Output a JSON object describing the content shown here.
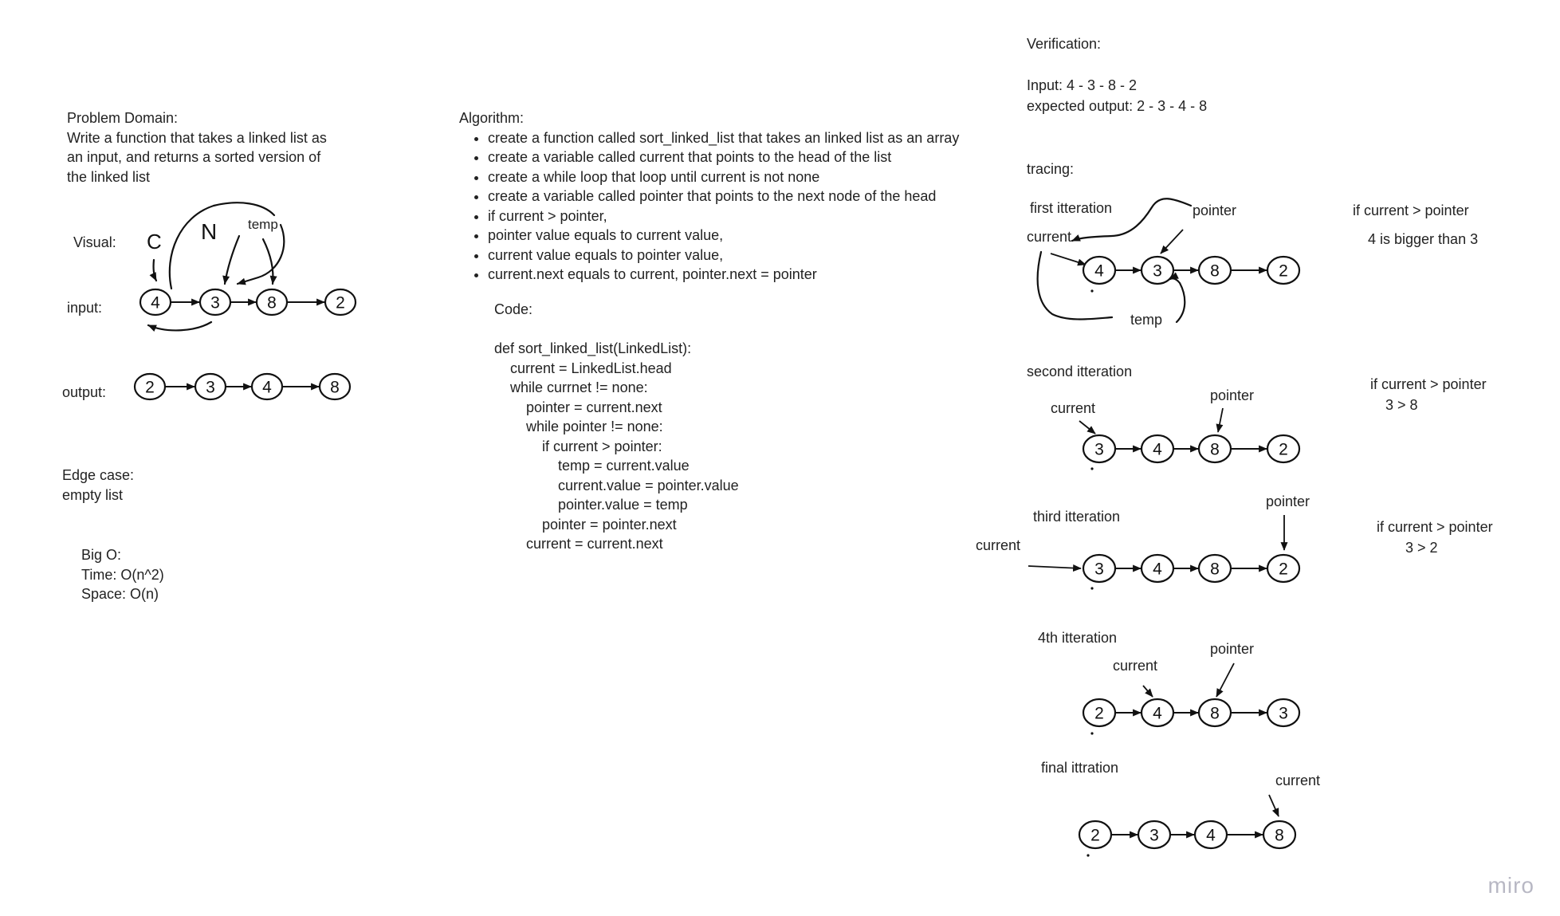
{
  "problem": {
    "heading": "Problem Domain:",
    "lines": [
      "Write a function that takes a linked list as",
      "an input, and returns a sorted version of",
      "the linked list"
    ]
  },
  "visual_label": "Visual:",
  "visual_marks": {
    "c": "C",
    "n": "N",
    "temp": "temp"
  },
  "input_label": "input:",
  "output_label": "output:",
  "input_list": [
    4,
    3,
    8,
    2
  ],
  "output_list": [
    2,
    3,
    4,
    8
  ],
  "edge": {
    "heading": "Edge case:",
    "text": "empty list"
  },
  "bigo": {
    "heading": "Big O:",
    "time": "Time: O(n^2)",
    "space": "Space: O(n)"
  },
  "algorithm": {
    "heading": "Algorithm:",
    "steps": [
      "create a function called sort_linked_list that takes an linked list as an array",
      "create a variable called current that points to the head of the list",
      "create a while loop that loop until current is not none",
      "create a variable called pointer that points to the next node of the head",
      "if current > pointer,",
      "pointer value equals to current value,",
      "current value equals to pointer value,",
      "current.next equals to current, pointer.next = pointer"
    ]
  },
  "code": {
    "heading": "Code:",
    "lines": [
      "def sort_linked_list(LinkedList):",
      "",
      "    current = LinkedList.head",
      "",
      "    while currnet != none:",
      "        pointer = current.next",
      "        while pointer != none:",
      "            if current > pointer:",
      "                temp = current.value",
      "                current.value = pointer.value",
      "                pointer.value = temp",
      "            pointer = pointer.next",
      "        current = current.next"
    ]
  },
  "verification": {
    "heading": "Verification:",
    "input": "Input: 4 - 3 - 8 - 2",
    "expected": "expected output: 2 - 3 - 4 - 8",
    "tracing": "tracing:"
  },
  "iterations": [
    {
      "title": "first itteration",
      "nodes": [
        4,
        3,
        8,
        2
      ],
      "current_label": "current",
      "pointer_label": "pointer",
      "temp_label": "temp",
      "cond": "if current > pointer",
      "note": "4 is bigger than 3"
    },
    {
      "title": "second itteration",
      "nodes": [
        3,
        4,
        8,
        2
      ],
      "current_label": "current",
      "pointer_label": "pointer",
      "cond": "if current > pointer",
      "note": "3 > 8"
    },
    {
      "title": "third itteration",
      "nodes": [
        3,
        4,
        8,
        2
      ],
      "current_label": "current",
      "pointer_label": "pointer",
      "cond": "if current > pointer",
      "note": "3 > 2"
    },
    {
      "title": "4th itteration",
      "nodes": [
        2,
        4,
        8,
        3
      ],
      "current_label": "current",
      "pointer_label": "pointer"
    },
    {
      "title": "final ittration",
      "nodes": [
        2,
        3,
        4,
        8
      ],
      "current_label": "current"
    }
  ],
  "watermark": "miro"
}
